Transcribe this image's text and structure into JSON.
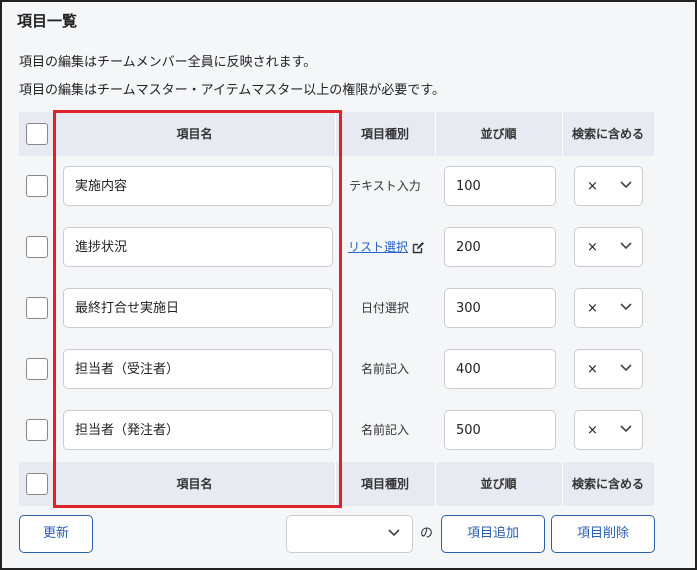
{
  "section_title": "項目一覧",
  "notes": [
    "項目の編集はチームメンバー全員に反映されます。",
    "項目の編集はチームマスター・アイテムマスター以上の権限が必要です。"
  ],
  "table": {
    "headers": {
      "name": "項目名",
      "type": "項目種別",
      "order": "並び順",
      "search": "検索に含める"
    },
    "rows": [
      {
        "name": "実施内容",
        "type": "テキスト入力",
        "type_is_link": false,
        "order": "100",
        "search": "×"
      },
      {
        "name": "進捗状況",
        "type": "リスト選択",
        "type_is_link": true,
        "order": "200",
        "search": "×"
      },
      {
        "name": "最終打合せ実施日",
        "type": "日付選択",
        "type_is_link": false,
        "order": "300",
        "search": "×"
      },
      {
        "name": "担当者（受注者）",
        "type": "名前記入",
        "type_is_link": false,
        "order": "400",
        "search": "×"
      },
      {
        "name": "担当者（発注者）",
        "type": "名前記入",
        "type_is_link": false,
        "order": "500",
        "search": "×"
      }
    ]
  },
  "footer": {
    "update_label": "更新",
    "select_value": "",
    "no_label": "の",
    "add_label": "項目追加",
    "delete_label": "項目削除"
  },
  "colors": {
    "highlight": "#e0232b",
    "link": "#2563c9",
    "button": "#2a5db0",
    "header_bg": "#e7eaf1"
  },
  "icons": {
    "edit": "edit-icon",
    "chevron": "chevron-down-icon"
  }
}
